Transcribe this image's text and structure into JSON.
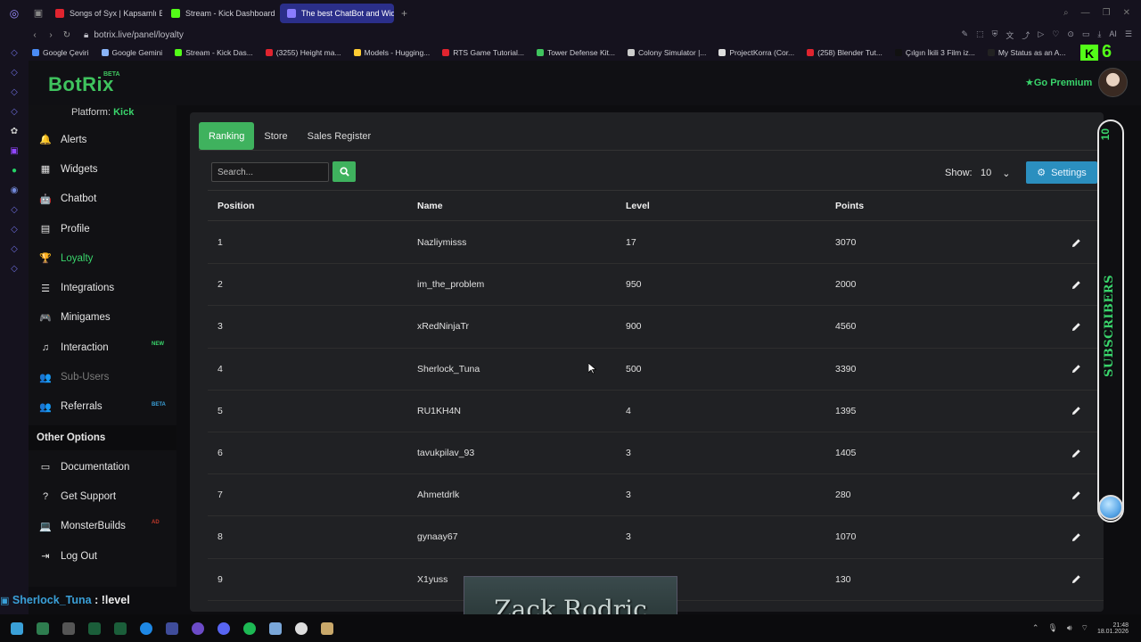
{
  "browser": {
    "tabs": [
      {
        "label": "Songs of Syx | Kapsamlı B",
        "color": "#e0242f",
        "active": false
      },
      {
        "label": "Stream - Kick Dashboard",
        "color": "#53fc18",
        "active": false
      },
      {
        "label": "The best ChatBot and Wid",
        "color": "#8a7dff",
        "active": true
      }
    ],
    "url": "botrix.live/panel/loyalty",
    "bookmarks": [
      {
        "label": "Google Çeviri",
        "color": "#4a8bf5"
      },
      {
        "label": "Google Gemini",
        "color": "#8ab4f8"
      },
      {
        "label": "Stream - Kick Das...",
        "color": "#53fc18"
      },
      {
        "label": "(3255) Height ma...",
        "color": "#e0242f"
      },
      {
        "label": "Models - Hugging...",
        "color": "#ffcc33"
      },
      {
        "label": "RTS Game Tutorial...",
        "color": "#e0242f"
      },
      {
        "label": "Tower Defense Kit...",
        "color": "#3fc35e"
      },
      {
        "label": "Colony Simulator |...",
        "color": "#cccccc"
      },
      {
        "label": "ProjectKorra (Cor...",
        "color": "#dddddd"
      },
      {
        "label": "(258) Blender Tut...",
        "color": "#e0242f"
      },
      {
        "label": "Çılgın İkili 3 Film iz...",
        "color": "#111111"
      },
      {
        "label": "My Status as an A...",
        "color": "#222222"
      }
    ],
    "kick_count": "6"
  },
  "app": {
    "logo": "BotRix",
    "logo_badge": "BETA",
    "go_premium": "Go Premium",
    "platform_label": "Platform:",
    "platform_value": "Kick"
  },
  "sidebar": {
    "items": [
      {
        "label": "Alerts",
        "icon": "bell-icon",
        "glyph": "🔔",
        "state": ""
      },
      {
        "label": "Widgets",
        "icon": "grid-icon",
        "glyph": "▦",
        "state": ""
      },
      {
        "label": "Chatbot",
        "icon": "bot-icon",
        "glyph": "🤖",
        "state": ""
      },
      {
        "label": "Profile",
        "icon": "id-card-icon",
        "glyph": "▤",
        "state": ""
      },
      {
        "label": "Loyalty",
        "icon": "trophy-icon",
        "glyph": "🏆",
        "state": "active"
      },
      {
        "label": "Integrations",
        "icon": "list-icon",
        "glyph": "☰",
        "state": ""
      },
      {
        "label": "Minigames",
        "icon": "gamepad-icon",
        "glyph": "🎮",
        "state": ""
      },
      {
        "label": "Interaction",
        "icon": "music-icon",
        "glyph": "♫",
        "state": "",
        "badge": "NEW",
        "badge_kind": "new"
      },
      {
        "label": "Sub-Users",
        "icon": "users-icon",
        "glyph": "👥",
        "state": "muted"
      },
      {
        "label": "Referrals",
        "icon": "users-icon",
        "glyph": "👥",
        "state": "",
        "badge": "BETA",
        "badge_kind": "beta"
      }
    ],
    "other_title": "Other Options",
    "other_items": [
      {
        "label": "Documentation",
        "icon": "document-icon",
        "glyph": "▭"
      },
      {
        "label": "Get Support",
        "icon": "question-icon",
        "glyph": "?"
      },
      {
        "label": "MonsterBuilds",
        "icon": "laptop-icon",
        "glyph": "💻",
        "badge": "AD",
        "badge_kind": "ad"
      },
      {
        "label": "Log Out",
        "icon": "logout-icon",
        "glyph": "⇥"
      }
    ]
  },
  "loyalty": {
    "tabs": [
      "Ranking",
      "Store",
      "Sales Register"
    ],
    "active_tab": "Ranking",
    "search_placeholder": "Search...",
    "show_label": "Show:",
    "show_value": "10",
    "settings_label": "Settings",
    "columns": [
      "Position",
      "Name",
      "Level",
      "Points"
    ],
    "rows": [
      {
        "position": "1",
        "name": "Nazliymisss",
        "level": "17",
        "points": "3070"
      },
      {
        "position": "2",
        "name": "im_the_problem",
        "level": "950",
        "points": "2000"
      },
      {
        "position": "3",
        "name": "xRedNinjaTr",
        "level": "900",
        "points": "4560"
      },
      {
        "position": "4",
        "name": "Sherlock_Tuna",
        "level": "500",
        "points": "3390"
      },
      {
        "position": "5",
        "name": "RU1KH4N",
        "level": "4",
        "points": "1395"
      },
      {
        "position": "6",
        "name": "tavukpilav_93",
        "level": "3",
        "points": "1405"
      },
      {
        "position": "7",
        "name": "Ahmetdrlk",
        "level": "3",
        "points": "280"
      },
      {
        "position": "8",
        "name": "gynaay67",
        "level": "3",
        "points": "1070"
      },
      {
        "position": "9",
        "name": "X1yuss",
        "level": "3",
        "points": "130"
      }
    ]
  },
  "overlay": {
    "subscriber_count": "10",
    "subscriber_label": "SUBSCRIBERS",
    "chat_user": "Sherlock_Tuna",
    "chat_message": ": !level",
    "banner": "Zack Rodric"
  },
  "taskbar": {
    "time": "21:48",
    "date": "18.01.2026"
  }
}
